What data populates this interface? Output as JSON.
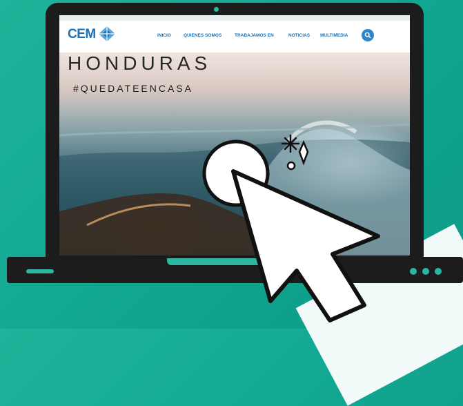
{
  "site": {
    "logo_text": "CEM"
  },
  "nav": {
    "items": [
      {
        "label": "INICIO"
      },
      {
        "label": "QUIENES SOMOS"
      },
      {
        "label": "TRABAJAMOS EN"
      },
      {
        "label": "NOTICIAS"
      },
      {
        "label": "MULTIMEDIA"
      }
    ]
  },
  "hero": {
    "title": "HONDURAS",
    "subtitle": "#QUEDATEENCASA"
  },
  "icons": {
    "search": "search-icon",
    "cursor": "mouse-pointer-icon",
    "sparkle": "sparkle-icon"
  },
  "colors": {
    "background": "#12a892",
    "brand_blue": "#1f6fb3",
    "accent_teal": "#2cb6a0",
    "laptop": "#1c1c1c"
  }
}
